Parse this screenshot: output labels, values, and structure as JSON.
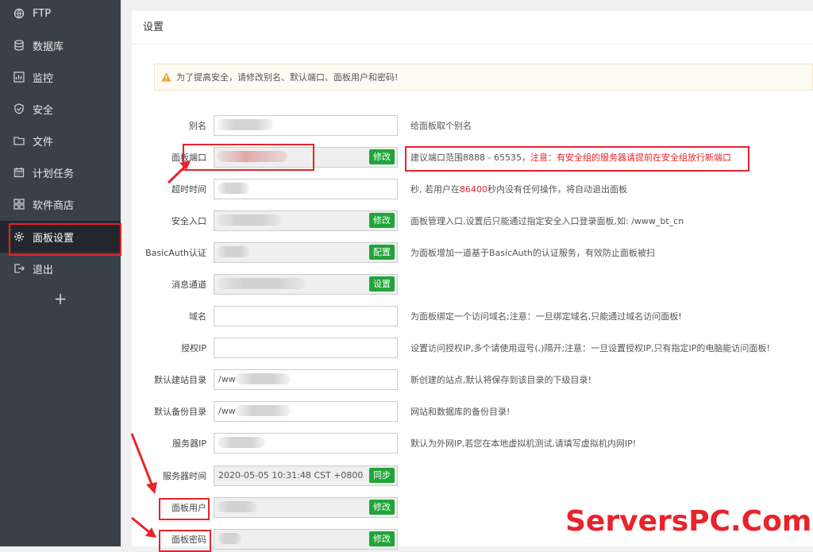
{
  "sidebar": {
    "items": [
      {
        "label": "FTP",
        "icon": "ftp-icon"
      },
      {
        "label": "数据库",
        "icon": "database-icon"
      },
      {
        "label": "监控",
        "icon": "monitor-icon"
      },
      {
        "label": "安全",
        "icon": "shield-icon"
      },
      {
        "label": "文件",
        "icon": "folder-icon"
      },
      {
        "label": "计划任务",
        "icon": "calendar-icon"
      },
      {
        "label": "软件商店",
        "icon": "apps-icon"
      },
      {
        "label": "面板设置",
        "icon": "gear-icon"
      },
      {
        "label": "退出",
        "icon": "logout-icon"
      }
    ],
    "add_label": "+"
  },
  "page": {
    "title": "设置",
    "alert": "为了提高安全，请修改别名、默认端口、面板用户和密码!"
  },
  "settings": {
    "alias": {
      "label": "别名",
      "value": "",
      "desc": "给面板取个别名"
    },
    "port": {
      "label": "面板端口",
      "value": "",
      "button": "修改",
      "desc": "建议端口范围8888 - 65535，",
      "desc_warn": "注意：有安全组的服务器请提前在安全组放行新端口"
    },
    "timeout": {
      "label": "超时时间",
      "value": "",
      "desc_pre": "秒, 若用户在",
      "desc_num": "86400",
      "desc_post": "秒内没有任何操作，将自动退出面板"
    },
    "entry": {
      "label": "安全入口",
      "value": "",
      "button": "修改",
      "desc": "面板管理入口,设置后只能通过指定安全入口登录面板,如: /www_bt_cn"
    },
    "basic_auth": {
      "label": "BasicAuth认证",
      "value": "",
      "button": "配置",
      "desc": "为面板增加一道基于BasicAuth的认证服务，有效防止面板被扫"
    },
    "channel": {
      "label": "消息通道",
      "value": "",
      "button": "设置",
      "desc": ""
    },
    "domain": {
      "label": "域名",
      "value": "",
      "desc": "为面板绑定一个访问域名;注意：一旦绑定域名,只能通过域名访问面板!"
    },
    "auth_ip": {
      "label": "授权IP",
      "value": "",
      "desc": "设置访问授权IP,多个请使用逗号(,)隔开;注意：一旦设置授权IP,只有指定IP的电脑能访问面板!"
    },
    "site_dir": {
      "label": "默认建站目录",
      "value": "/ww",
      "desc": "新创建的站点,默认将保存到该目录的下级目录!"
    },
    "backup_dir": {
      "label": "默认备份目录",
      "value": "/ww",
      "desc": "网站和数据库的备份目录!"
    },
    "server_ip": {
      "label": "服务器IP",
      "value": "",
      "desc": "默认为外网IP,若您在本地虚拟机测试,请填写虚拟机内网IP!"
    },
    "server_time": {
      "label": "服务器时间",
      "value": "2020-05-05 10:31:48 CST +0800",
      "button": "同步",
      "desc": ""
    },
    "panel_user": {
      "label": "面板用户",
      "value": "",
      "button": "修改",
      "desc": ""
    },
    "panel_pass": {
      "label": "面板密码",
      "value": "",
      "button": "修改",
      "desc": ""
    }
  },
  "watermark": "ServersPC.Com",
  "colors": {
    "accent_green": "#20a53a",
    "highlight_red": "#e8232a",
    "sidebar_bg": "#3a4048"
  }
}
